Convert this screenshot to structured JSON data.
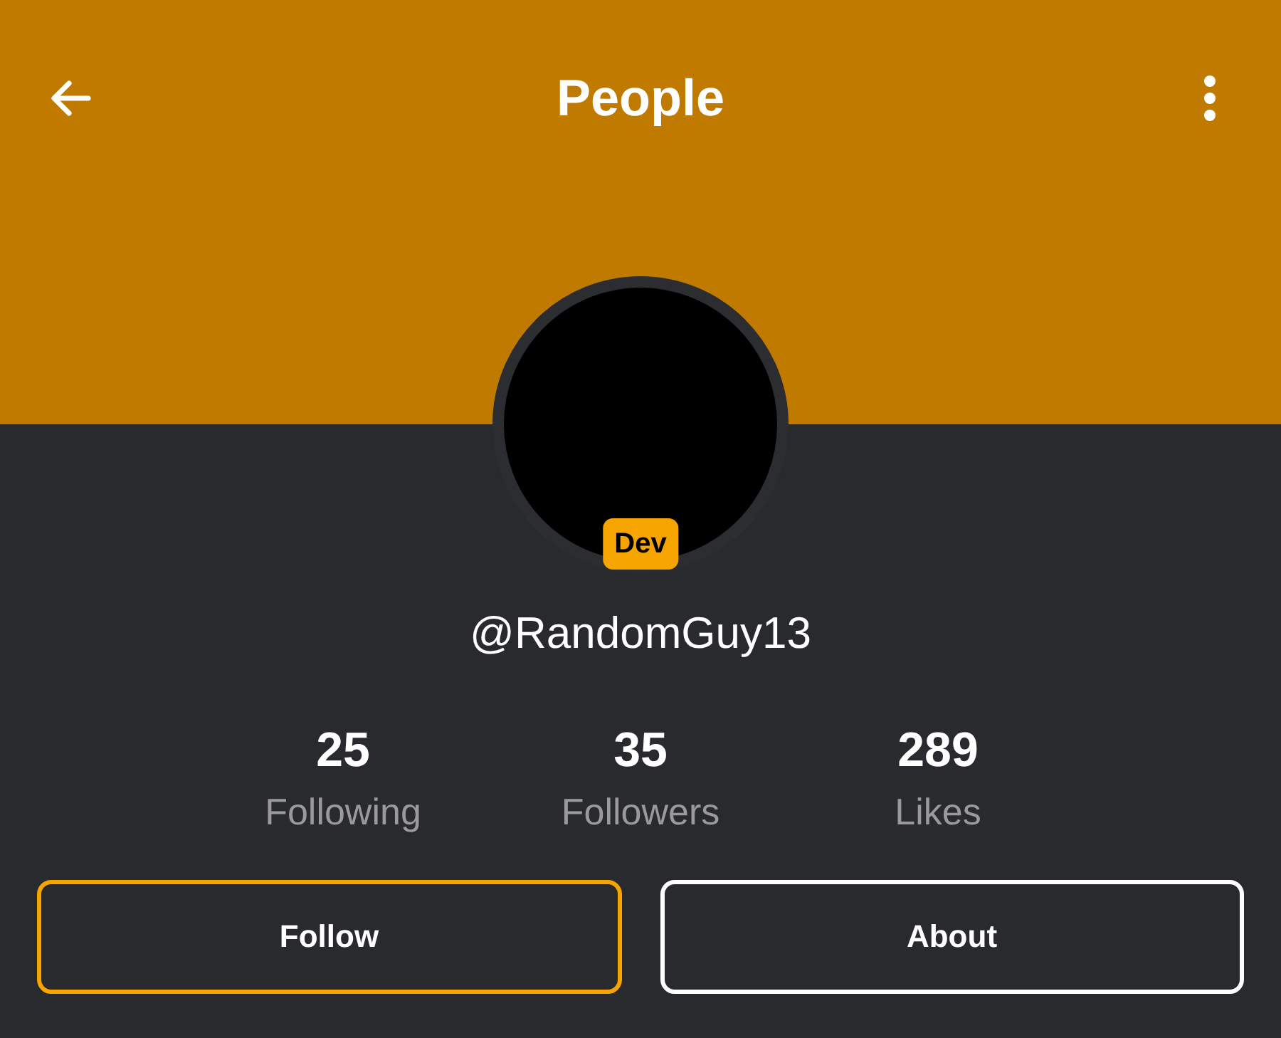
{
  "top_bar": {
    "title": "People"
  },
  "profile": {
    "badge": "Dev",
    "username": "@RandomGuy13"
  },
  "stats": [
    {
      "value": "25",
      "label": "Following"
    },
    {
      "value": "35",
      "label": "Followers"
    },
    {
      "value": "289",
      "label": "Likes"
    }
  ],
  "buttons": [
    {
      "label": "Follow",
      "kind": "primary"
    },
    {
      "label": "About",
      "kind": "secondary"
    }
  ]
}
